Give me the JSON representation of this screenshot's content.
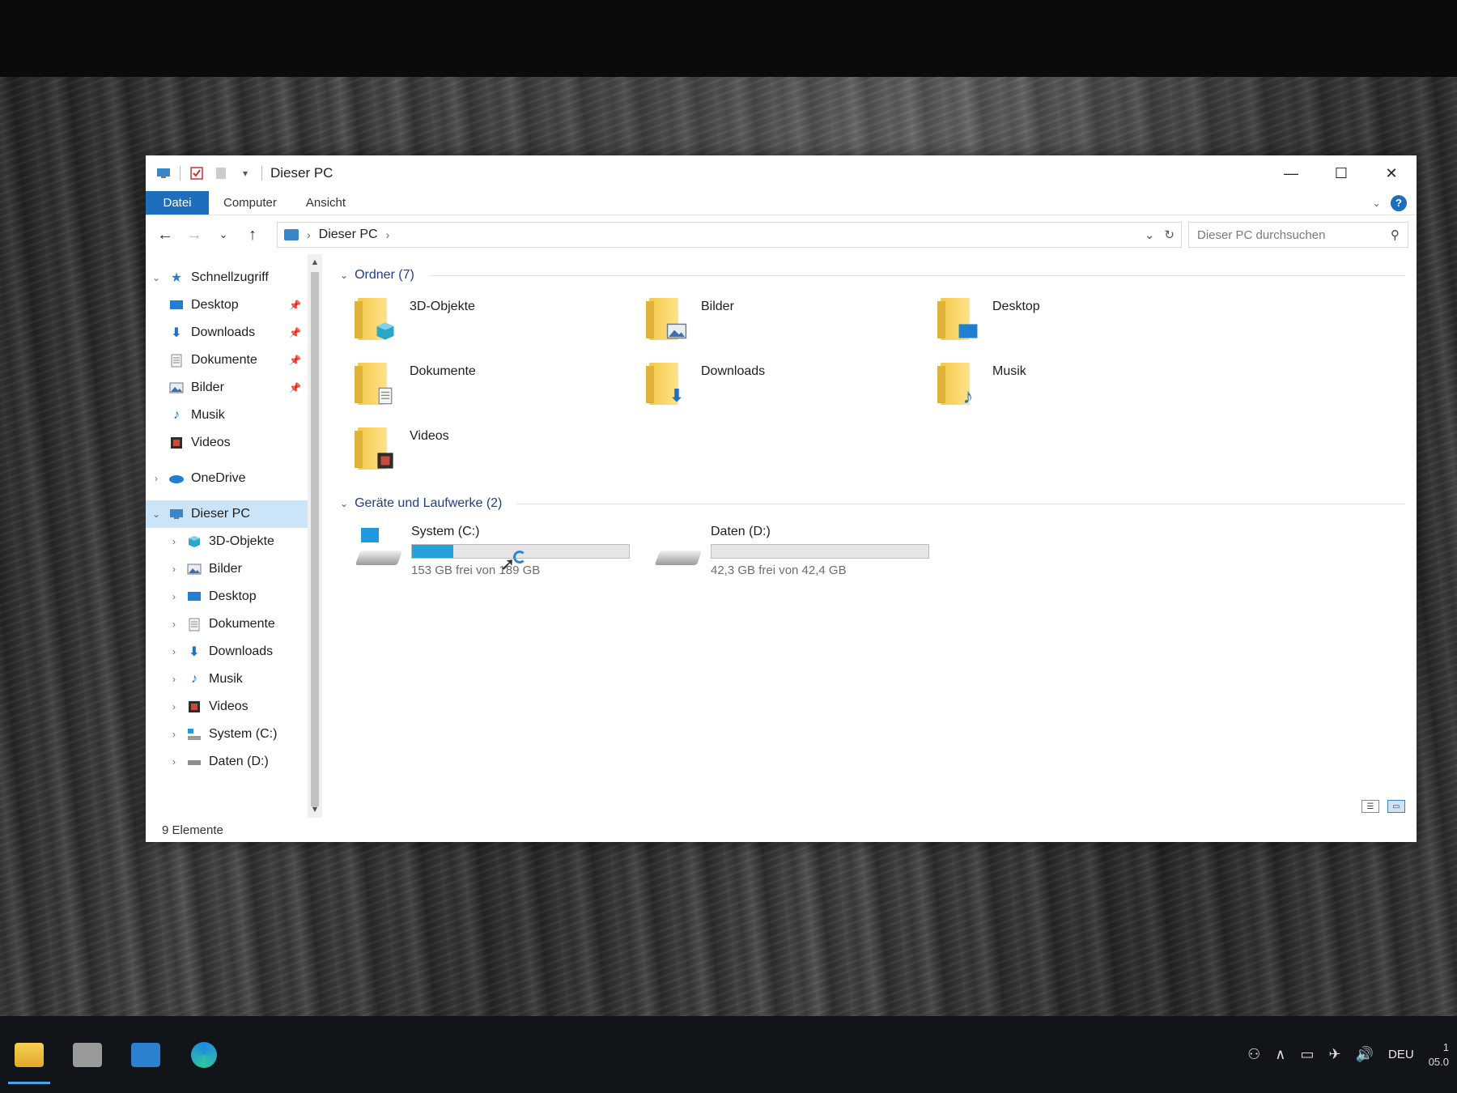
{
  "window": {
    "title": "Dieser PC",
    "controls": {
      "minimize": "—",
      "maximize": "☐",
      "close": "✕"
    }
  },
  "ribbon": {
    "tabs": [
      "Datei",
      "Computer",
      "Ansicht"
    ]
  },
  "navigation": {
    "back_icon": "arrow-left-icon",
    "forward_icon": "arrow-right-icon",
    "recent_icon": "chevron-down-icon",
    "up_icon": "arrow-up-icon",
    "breadcrumb": [
      "Dieser PC"
    ],
    "search_placeholder": "Dieser PC durchsuchen"
  },
  "sidebar": {
    "quick_access": {
      "label": "Schnellzugriff",
      "items": [
        {
          "label": "Desktop",
          "icon": "desktop-icon",
          "pinned": true
        },
        {
          "label": "Downloads",
          "icon": "download-arrow-icon",
          "pinned": true
        },
        {
          "label": "Dokumente",
          "icon": "document-icon",
          "pinned": true
        },
        {
          "label": "Bilder",
          "icon": "picture-icon",
          "pinned": true
        },
        {
          "label": "Musik",
          "icon": "music-note-icon",
          "pinned": false
        },
        {
          "label": "Videos",
          "icon": "film-icon",
          "pinned": false
        }
      ]
    },
    "onedrive": {
      "label": "OneDrive",
      "icon": "cloud-icon"
    },
    "this_pc": {
      "label": "Dieser PC",
      "items": [
        {
          "label": "3D-Objekte",
          "icon": "cube-icon"
        },
        {
          "label": "Bilder",
          "icon": "picture-icon"
        },
        {
          "label": "Desktop",
          "icon": "desktop-icon"
        },
        {
          "label": "Dokumente",
          "icon": "document-icon"
        },
        {
          "label": "Downloads",
          "icon": "download-arrow-icon"
        },
        {
          "label": "Musik",
          "icon": "music-note-icon"
        },
        {
          "label": "Videos",
          "icon": "film-icon"
        },
        {
          "label": "System (C:)",
          "icon": "system-drive-icon"
        },
        {
          "label": "Daten (D:)",
          "icon": "drive-icon"
        }
      ]
    }
  },
  "main": {
    "folders_header": "Ordner (7)",
    "folders": [
      {
        "name": "3D-Objekte",
        "overlay": "cube-icon"
      },
      {
        "name": "Bilder",
        "overlay": "picture-icon"
      },
      {
        "name": "Desktop",
        "overlay": "desktop-icon"
      },
      {
        "name": "Dokumente",
        "overlay": "document-icon"
      },
      {
        "name": "Downloads",
        "overlay": "download-arrow-icon"
      },
      {
        "name": "Musik",
        "overlay": "music-note-icon"
      },
      {
        "name": "Videos",
        "overlay": "film-icon"
      }
    ],
    "drives_header": "Geräte und Laufwerke (2)",
    "drives": [
      {
        "name": "System (C:)",
        "free_text": "153 GB frei von 189 GB",
        "used_fraction": 0.19,
        "icon": "system-drive-icon"
      },
      {
        "name": "Daten (D:)",
        "free_text": "42,3 GB frei von 42,4 GB",
        "used_fraction": 0.0,
        "icon": "drive-icon"
      }
    ]
  },
  "status": {
    "items": "9 Elemente"
  },
  "taskbar": {
    "apps": [
      "file-explorer-icon",
      "store-icon",
      "mail-icon",
      "edge-icon"
    ],
    "tray_language": "DEU",
    "tray_icons": [
      "people-icon",
      "chevron-up-icon",
      "battery-icon",
      "airplane-icon",
      "volume-icon"
    ],
    "clock_time": "1",
    "clock_date": "05.0"
  },
  "colors": {
    "accent": "#1d6fbe",
    "drive_bar": "#26a0da",
    "selection": "#cce4f7"
  }
}
